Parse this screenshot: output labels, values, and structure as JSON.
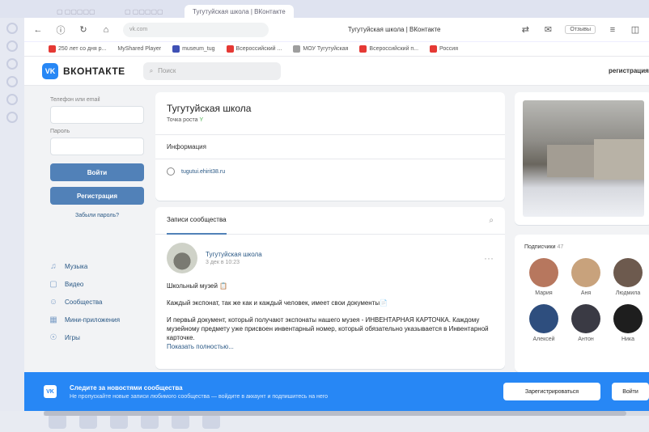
{
  "browser": {
    "active_tab": "Тугутуйская школа | ВКонтакте",
    "url": "vk.com",
    "page_title": "Тугутуйская школа | ВКонтакте",
    "reviews": "Отзывы",
    "bookmarks": [
      {
        "label": "250 лет со дня р...",
        "color": "#e53935"
      },
      {
        "label": "MyShared Player",
        "color": "#ffffff"
      },
      {
        "label": "museum_tug",
        "color": "#3f51b5"
      },
      {
        "label": "Всероссийский ...",
        "color": "#e53935"
      },
      {
        "label": "МОУ Тугутуйская",
        "color": "#9e9e9e"
      },
      {
        "label": "Всероссийский п...",
        "color": "#e53935"
      },
      {
        "label": "Россия",
        "color": "#e53935"
      }
    ]
  },
  "vk": {
    "logo_text": "ВКОНТАКТЕ",
    "search_placeholder": "Поиск",
    "top_register": "регистрация"
  },
  "login": {
    "phone_label": "Телефон или email",
    "password_label": "Пароль",
    "login_button": "Войти",
    "register_button": "Регистрация",
    "forgot": "Забыли пароль?"
  },
  "nav": [
    {
      "icon": "music-icon",
      "glyph": "♫",
      "label": "Музыка"
    },
    {
      "icon": "video-icon",
      "glyph": "▢",
      "label": "Видео"
    },
    {
      "icon": "communities-icon",
      "glyph": "☺",
      "label": "Сообщества"
    },
    {
      "icon": "apps-icon",
      "glyph": "▦",
      "label": "Мини-приложения"
    },
    {
      "icon": "games-icon",
      "glyph": "☉",
      "label": "Игры"
    }
  ],
  "group": {
    "name": "Тугутуйская школа",
    "status": "Точка роста",
    "info_title": "Информация",
    "link": "tugutui.ehirit38.ru"
  },
  "posts": {
    "tab": "Записи сообщества",
    "author": "Тугутуйская школа",
    "date": "3 дек в 10:23",
    "p1": "Школьный музей 📋",
    "p2": "Каждый экспонат, так же как и каждый человек, имеет свои документы📄",
    "p3": "И первый документ, который получают экспонаты нашего музея - ИНВЕНТАРНАЯ КАРТОЧКА. Каждому музейному предмету уже присвоен инвентарный номер, который обязательно указывается в Инвентарной карточке.",
    "more": "Показать полностью..."
  },
  "subscribers": {
    "title": "Подписчики",
    "count": "47",
    "people": [
      {
        "name": "Мария",
        "color": "#b7775e"
      },
      {
        "name": "Аня",
        "color": "#c8a27c"
      },
      {
        "name": "Людмила",
        "color": "#6d5a4e"
      },
      {
        "name": "Алексей",
        "color": "#2e4e7e"
      },
      {
        "name": "Антон",
        "color": "#3a3a44"
      },
      {
        "name": "Ника",
        "color": "#1e1e1e"
      }
    ]
  },
  "banner": {
    "title": "Следите за новостями сообщества",
    "subtitle": "Не пропускайте новые записи любимого сообщества — войдите в аккаунт и подпишитесь на него",
    "register_button": "Зарегистрироваться",
    "login_button": "Войти"
  }
}
